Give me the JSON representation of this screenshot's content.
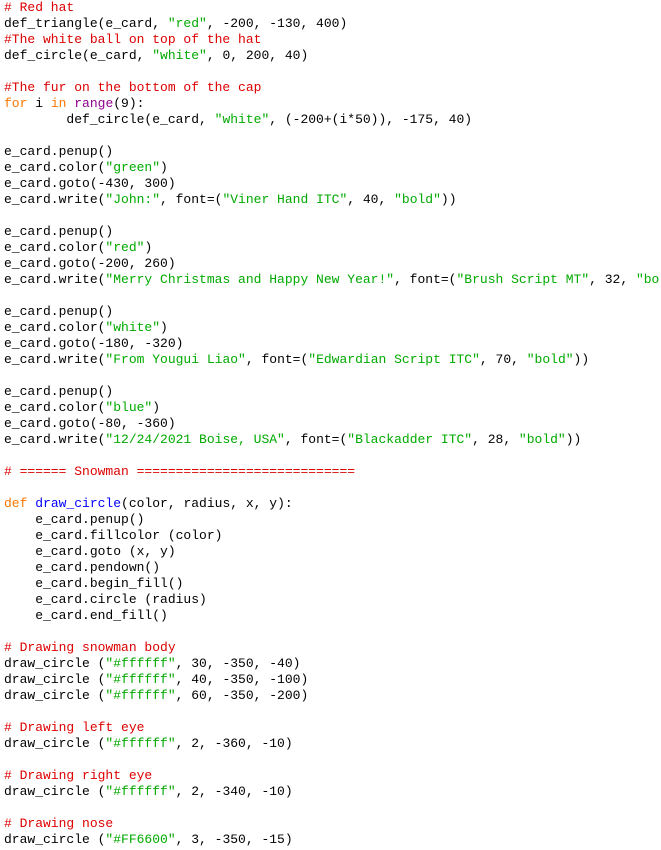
{
  "colors": {
    "comment": "#dd0000",
    "string": "#00aa00",
    "keyword": "#ff7700",
    "builtin": "#900090",
    "definition": "#0000ff",
    "text": "#000000"
  },
  "code_lines": [
    [
      [
        "# Red hat",
        "c"
      ]
    ],
    [
      [
        "def_triangle(e_card, ",
        ""
      ],
      [
        "\"red\"",
        "s"
      ],
      [
        ", -200, -130, 400)",
        ""
      ]
    ],
    [
      [
        "#The white ball on top of the hat",
        "c"
      ]
    ],
    [
      [
        "def_circle(e_card, ",
        ""
      ],
      [
        "\"white\"",
        "s"
      ],
      [
        ", 0, 200, 40)",
        ""
      ]
    ],
    [],
    [
      [
        "#The fur on the bottom of the cap",
        "c"
      ]
    ],
    [
      [
        "for",
        "k"
      ],
      [
        " i ",
        ""
      ],
      [
        "in",
        "k"
      ],
      [
        " ",
        ""
      ],
      [
        "range",
        "b"
      ],
      [
        "(9):",
        ""
      ]
    ],
    [
      [
        "        def_circle(e_card, ",
        ""
      ],
      [
        "\"white\"",
        "s"
      ],
      [
        ", (-200+(i*50)), -175, 40)",
        ""
      ]
    ],
    [],
    [
      [
        "e_card.penup()",
        ""
      ]
    ],
    [
      [
        "e_card.color(",
        ""
      ],
      [
        "\"green\"",
        "s"
      ],
      [
        ")",
        ""
      ]
    ],
    [
      [
        "e_card.goto(-430, 300)",
        ""
      ]
    ],
    [
      [
        "e_card.write(",
        ""
      ],
      [
        "\"John:\"",
        "s"
      ],
      [
        ", font=(",
        ""
      ],
      [
        "\"Viner Hand ITC\"",
        "s"
      ],
      [
        ", 40, ",
        ""
      ],
      [
        "\"bold\"",
        "s"
      ],
      [
        "))",
        ""
      ]
    ],
    [],
    [
      [
        "e_card.penup()",
        ""
      ]
    ],
    [
      [
        "e_card.color(",
        ""
      ],
      [
        "\"red\"",
        "s"
      ],
      [
        ")",
        ""
      ]
    ],
    [
      [
        "e_card.goto(-200, 260)",
        ""
      ]
    ],
    [
      [
        "e_card.write(",
        ""
      ],
      [
        "\"Merry Christmas and Happy New Year!\"",
        "s"
      ],
      [
        ", font=(",
        ""
      ],
      [
        "\"Brush Script MT\"",
        "s"
      ],
      [
        ", 32, ",
        ""
      ],
      [
        "\"bold\"",
        "s"
      ],
      [
        "))",
        ""
      ]
    ],
    [],
    [
      [
        "e_card.penup()",
        ""
      ]
    ],
    [
      [
        "e_card.color(",
        ""
      ],
      [
        "\"white\"",
        "s"
      ],
      [
        ")",
        ""
      ]
    ],
    [
      [
        "e_card.goto(-180, -320)",
        ""
      ]
    ],
    [
      [
        "e_card.write(",
        ""
      ],
      [
        "\"From Yougui Liao\"",
        "s"
      ],
      [
        ", font=(",
        ""
      ],
      [
        "\"Edwardian Script ITC\"",
        "s"
      ],
      [
        ", 70, ",
        ""
      ],
      [
        "\"bold\"",
        "s"
      ],
      [
        "))",
        ""
      ]
    ],
    [],
    [
      [
        "e_card.penup()",
        ""
      ]
    ],
    [
      [
        "e_card.color(",
        ""
      ],
      [
        "\"blue\"",
        "s"
      ],
      [
        ")",
        ""
      ]
    ],
    [
      [
        "e_card.goto(-80, -360)",
        ""
      ]
    ],
    [
      [
        "e_card.write(",
        ""
      ],
      [
        "\"12/24/2021 Boise, USA\"",
        "s"
      ],
      [
        ", font=(",
        ""
      ],
      [
        "\"Blackadder ITC\"",
        "s"
      ],
      [
        ", 28, ",
        ""
      ],
      [
        "\"bold\"",
        "s"
      ],
      [
        "))",
        ""
      ]
    ],
    [],
    [
      [
        "# ====== Snowman ============================",
        "c"
      ]
    ],
    [],
    [
      [
        "def",
        "k"
      ],
      [
        " ",
        ""
      ],
      [
        "draw_circle",
        "d"
      ],
      [
        "(color, radius, x, y):",
        ""
      ]
    ],
    [
      [
        "    e_card.penup()",
        ""
      ]
    ],
    [
      [
        "    e_card.fillcolor (color)",
        ""
      ]
    ],
    [
      [
        "    e_card.goto (x, y)",
        ""
      ]
    ],
    [
      [
        "    e_card.pendown()",
        ""
      ]
    ],
    [
      [
        "    e_card.begin_fill()",
        ""
      ]
    ],
    [
      [
        "    e_card.circle (radius)",
        ""
      ]
    ],
    [
      [
        "    e_card.end_fill()",
        ""
      ]
    ],
    [],
    [
      [
        "# Drawing snowman body",
        "c"
      ]
    ],
    [
      [
        "draw_circle (",
        ""
      ],
      [
        "\"#ffffff\"",
        "s"
      ],
      [
        ", 30, -350, -40)",
        ""
      ]
    ],
    [
      [
        "draw_circle (",
        ""
      ],
      [
        "\"#ffffff\"",
        "s"
      ],
      [
        ", 40, -350, -100)",
        ""
      ]
    ],
    [
      [
        "draw_circle (",
        ""
      ],
      [
        "\"#ffffff\"",
        "s"
      ],
      [
        ", 60, -350, -200)",
        ""
      ]
    ],
    [],
    [
      [
        "# Drawing left eye",
        "c"
      ]
    ],
    [
      [
        "draw_circle (",
        ""
      ],
      [
        "\"#ffffff\"",
        "s"
      ],
      [
        ", 2, -360, -10)",
        ""
      ]
    ],
    [],
    [
      [
        "# Drawing right eye",
        "c"
      ]
    ],
    [
      [
        "draw_circle (",
        ""
      ],
      [
        "\"#ffffff\"",
        "s"
      ],
      [
        ", 2, -340, -10)",
        ""
      ]
    ],
    [],
    [
      [
        "# Drawing nose",
        "c"
      ]
    ],
    [
      [
        "draw_circle (",
        ""
      ],
      [
        "\"#FF6600\"",
        "s"
      ],
      [
        ", 3, -350, -15)",
        ""
      ]
    ]
  ]
}
